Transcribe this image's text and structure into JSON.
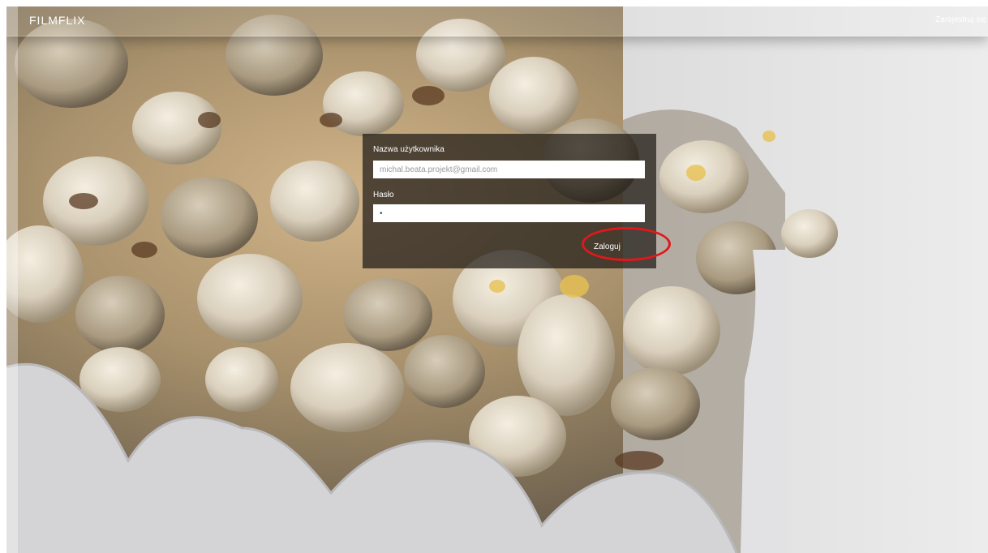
{
  "navbar": {
    "brand": "FILMFLIX",
    "register_link": "Zarejestruj się"
  },
  "login_form": {
    "username_label": "Nazwa użytkownika",
    "username_value": "michal.beata.projekt@gmail.com",
    "password_label": "Hasło",
    "password_value": "•",
    "submit_label": "Zaloguj"
  },
  "colors": {
    "annotation": "#e0181b",
    "panel": "#1e1a16",
    "text": "#ffffff"
  },
  "icons": {
    "background": "popcorn-photo"
  }
}
